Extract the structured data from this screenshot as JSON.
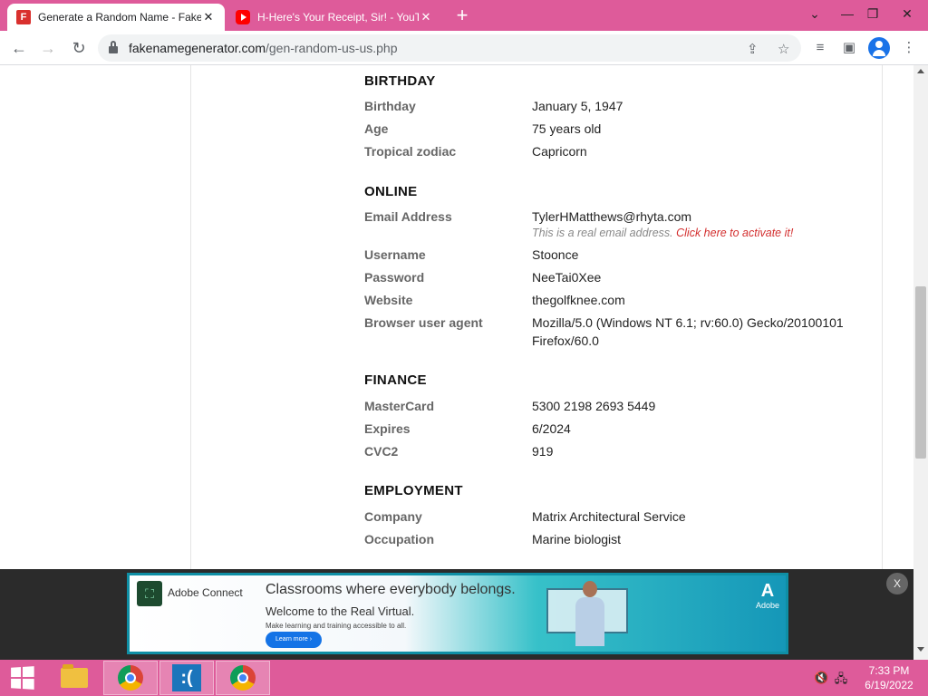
{
  "browser": {
    "tabs": [
      {
        "title": "Generate a Random Name - Fake",
        "icon": "fakename-favicon-icon",
        "active": true
      },
      {
        "title": "H-Here's Your Receipt, Sir! - YouTube",
        "icon": "youtube-favicon-icon",
        "active": false
      }
    ],
    "url_host": "fakenamegenerator.com",
    "url_path": "/gen-random-us-us.php"
  },
  "sections": {
    "birthday": {
      "heading": "BIRTHDAY",
      "rows": [
        {
          "label": "Birthday",
          "value": "January 5, 1947"
        },
        {
          "label": "Age",
          "value": "75 years old"
        },
        {
          "label": "Tropical zodiac",
          "value": "Capricorn"
        }
      ]
    },
    "online": {
      "heading": "ONLINE",
      "email_label": "Email Address",
      "email_value": "TylerHMatthews@rhyta.com",
      "email_note": "This is a real email address.",
      "email_link": "Click here to activate it!",
      "rows": [
        {
          "label": "Username",
          "value": "Stoonce"
        },
        {
          "label": "Password",
          "value": "NeeTai0Xee"
        },
        {
          "label": "Website",
          "value": "thegolfknee.com"
        }
      ],
      "ua_label": "Browser user agent",
      "ua_line1": "Mozilla/5.0 (Windows NT 6.1; rv:60.0) Gecko/20100101",
      "ua_line2": "Firefox/60.0"
    },
    "finance": {
      "heading": "FINANCE",
      "rows": [
        {
          "label": "MasterCard",
          "value": "5300 2198 2693 5449"
        },
        {
          "label": "Expires",
          "value": "6/2024"
        },
        {
          "label": "CVC2",
          "value": "919"
        }
      ]
    },
    "employment": {
      "heading": "EMPLOYMENT",
      "rows": [
        {
          "label": "Company",
          "value": "Matrix Architectural Service"
        },
        {
          "label": "Occupation",
          "value": "Marine biologist"
        }
      ]
    }
  },
  "ad": {
    "brand": "Adobe Connect",
    "headline": "Classrooms where everybody belongs.",
    "subhead": "Welcome to the Real Virtual.",
    "small": "Make learning and training accessible to all.",
    "button": "Learn more ›",
    "adobe": "Adobe",
    "close": "X"
  },
  "taskbar": {
    "time": "7:33 PM",
    "date": "6/19/2022"
  }
}
